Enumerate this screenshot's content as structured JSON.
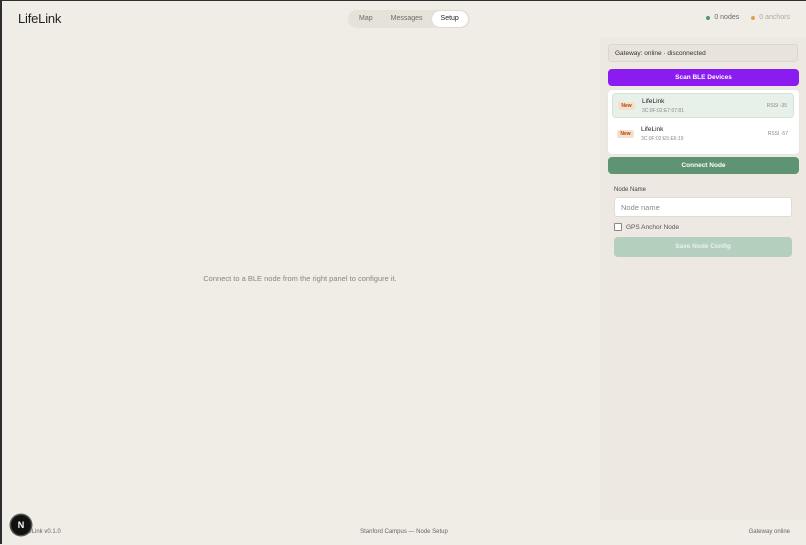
{
  "header": {
    "logo": "LifeLink",
    "tabs": [
      {
        "label": "Map",
        "active": false
      },
      {
        "label": "Messages",
        "active": false
      },
      {
        "label": "Setup",
        "active": true
      }
    ],
    "stats": {
      "nodes": "0 nodes",
      "anchors": "0 anchors",
      "nodes_color": "#4c9a6a",
      "anchors_color": "#e2a24a"
    }
  },
  "main": {
    "message": "Connect to a BLE node from the right panel to configure it."
  },
  "panel": {
    "gateway_status": "Gateway: online · disconnected",
    "scan_button": "Scan BLE Devices",
    "devices": [
      {
        "badge": "New",
        "name": "LifeLink",
        "mac": "3C:0F:02:E7:07:81",
        "rssi": "RSSI -35",
        "selected": true
      },
      {
        "badge": "New",
        "name": "LifeLink",
        "mac": "3C:0F:02:E5:E6:19",
        "rssi": "RSSI -57",
        "selected": false
      }
    ],
    "connect_button": "Connect Node",
    "node_name_label": "Node Name",
    "node_name_placeholder": "Node name",
    "node_name_value": "",
    "gps_anchor_label": "GPS Anchor Node",
    "gps_anchor_checked": false,
    "save_button": "Save Node Config"
  },
  "footer": {
    "version": "LifeLink v0.1.0",
    "center": "Stanford Campus — Node Setup",
    "right": "Gateway online"
  },
  "dev_badge": "N",
  "colors": {
    "accent_purple": "#8a1cf0",
    "accent_green": "#5e9474",
    "background": "#f0ede7"
  }
}
